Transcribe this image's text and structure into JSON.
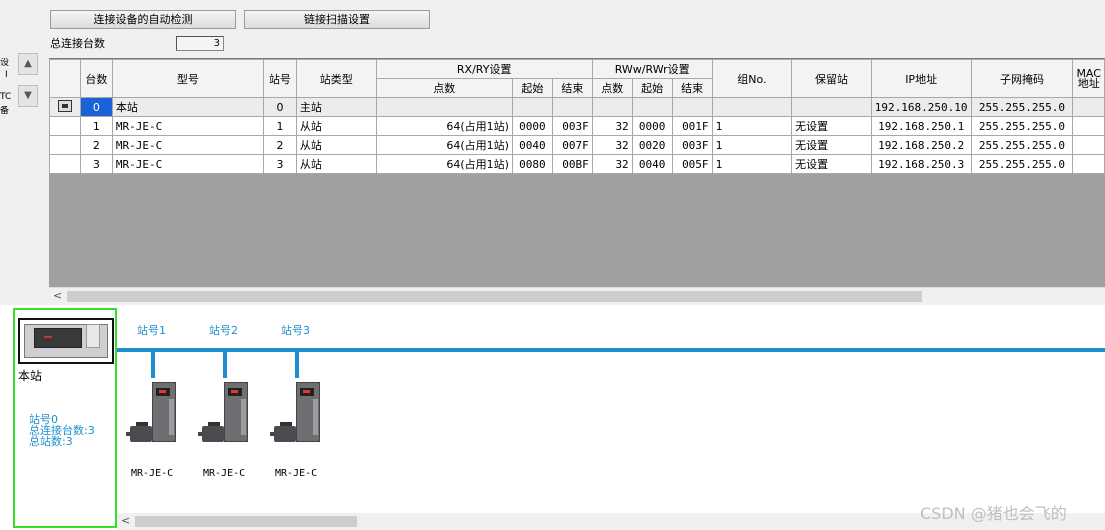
{
  "toolbar": {
    "auto_detect_label": "连接设备的自动检测",
    "link_scan_label": "链接扫描设置"
  },
  "summary": {
    "total_label": "总连接台数",
    "total_value": "3"
  },
  "edge_fragments": [
    "设",
    "I",
    "TC",
    "备"
  ],
  "table": {
    "headers": {
      "count": "台数",
      "model": "型号",
      "station_no": "站号",
      "station_type": "站类型",
      "rxry_group": "RX/RY设置",
      "rww_group": "RWw/RWr设置",
      "group_no": "组No.",
      "reserved": "保留站",
      "ip": "IP地址",
      "subnet": "子网掩码",
      "mac": "MAC地址",
      "points": "点数",
      "start": "起始",
      "end": "结束"
    },
    "rows": [
      {
        "count": "0",
        "model": "本站",
        "station": "0",
        "type": "主站",
        "rx_points": "",
        "rx_start": "",
        "rx_end": "",
        "rw_points": "",
        "rw_start": "",
        "rw_end": "",
        "group": "",
        "reserved": "",
        "ip": "192.168.250.10",
        "subnet": "255.255.255.0"
      },
      {
        "count": "1",
        "model": "MR-JE-C",
        "station": "1",
        "type": "从站",
        "rx_points": "64(占用1站)",
        "rx_start": "0000",
        "rx_end": "003F",
        "rw_points": "32",
        "rw_start": "0000",
        "rw_end": "001F",
        "group": "1",
        "reserved": "无设置",
        "ip": "192.168.250.1",
        "subnet": "255.255.255.0"
      },
      {
        "count": "2",
        "model": "MR-JE-C",
        "station": "2",
        "type": "从站",
        "rx_points": "64(占用1站)",
        "rx_start": "0040",
        "rx_end": "007F",
        "rw_points": "32",
        "rw_start": "0020",
        "rw_end": "003F",
        "group": "1",
        "reserved": "无设置",
        "ip": "192.168.250.2",
        "subnet": "255.255.255.0"
      },
      {
        "count": "3",
        "model": "MR-JE-C",
        "station": "3",
        "type": "从站",
        "rx_points": "64(占用1站)",
        "rx_start": "0080",
        "rx_end": "00BF",
        "rw_points": "32",
        "rw_start": "0040",
        "rw_end": "005F",
        "group": "1",
        "reserved": "无设置",
        "ip": "192.168.250.3",
        "subnet": "255.255.255.0"
      }
    ]
  },
  "network": {
    "host_label": "本站",
    "host_info": [
      "站号0",
      "总连接台数:3",
      "总站数:3"
    ],
    "stations": [
      {
        "label": "站号1",
        "model": "MR-JE-C"
      },
      {
        "label": "站号2",
        "model": "MR-JE-C"
      },
      {
        "label": "站号3",
        "model": "MR-JE-C"
      }
    ]
  },
  "watermark": "CSDN @猪也会飞的"
}
